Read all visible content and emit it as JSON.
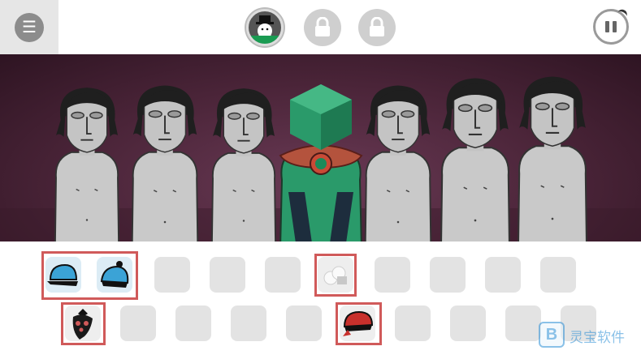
{
  "topbar": {
    "menu_icon_glyph": "☰",
    "characters": [
      {
        "icon": "snowman-hat-icon",
        "state": "active"
      },
      {
        "icon": "lock-icon",
        "state": "locked"
      },
      {
        "icon": "lock-icon",
        "state": "locked"
      }
    ],
    "pause_icon": "pause-icon"
  },
  "stage": {
    "performers": [
      {
        "kind": "idle-singer"
      },
      {
        "kind": "idle-singer"
      },
      {
        "kind": "idle-singer"
      },
      {
        "kind": "costumed-green-cube-head"
      },
      {
        "kind": "idle-singer"
      },
      {
        "kind": "idle-singer"
      },
      {
        "kind": "idle-singer"
      }
    ]
  },
  "tray": {
    "row1": [
      {
        "icon": "blue-cap-icon",
        "state": "selected"
      },
      {
        "icon": "blue-beanie-icon",
        "state": "selected"
      },
      {
        "icon": "",
        "state": "empty"
      },
      {
        "icon": "",
        "state": "empty"
      },
      {
        "icon": "",
        "state": "empty"
      },
      {
        "icon": "white-cloud-icon",
        "state": "selected"
      },
      {
        "icon": "",
        "state": "empty"
      },
      {
        "icon": "",
        "state": "empty"
      },
      {
        "icon": "",
        "state": "empty"
      },
      {
        "icon": "",
        "state": "empty"
      }
    ],
    "row2": [
      {
        "icon": "black-bird-mask-icon",
        "state": "selected"
      },
      {
        "icon": "",
        "state": "empty"
      },
      {
        "icon": "",
        "state": "empty"
      },
      {
        "icon": "",
        "state": "empty"
      },
      {
        "icon": "",
        "state": "empty"
      },
      {
        "icon": "red-bandana-icon",
        "state": "selected"
      },
      {
        "icon": "",
        "state": "empty"
      },
      {
        "icon": "",
        "state": "empty"
      },
      {
        "icon": "",
        "state": "empty"
      },
      {
        "icon": "",
        "state": "empty"
      }
    ]
  },
  "watermark": {
    "logo_letter": "B",
    "text": "灵宝软件"
  },
  "colors": {
    "selection": "#d05a5a",
    "active_ring": "#1a9b52",
    "stage": "#4a2438",
    "slot": "#e3e3e3"
  }
}
